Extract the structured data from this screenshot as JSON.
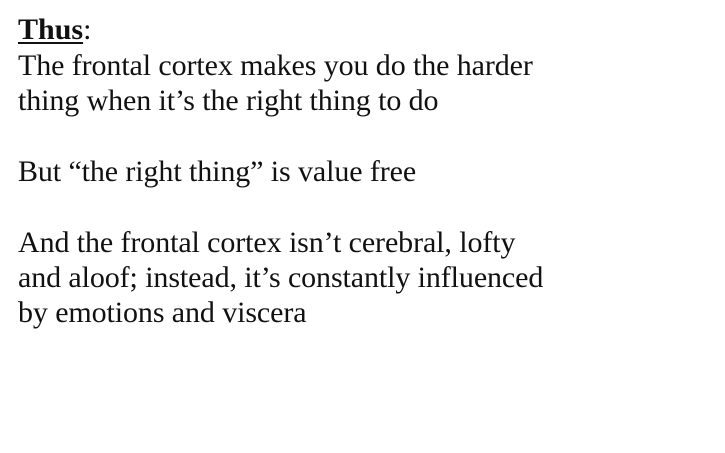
{
  "heading": {
    "word": "Thus",
    "colon": ":"
  },
  "paragraphs": [
    {
      "lines": [
        "The frontal cortex makes you do the harder",
        "thing when it’s the right thing to do"
      ]
    },
    {
      "lines": [
        "But “the right thing” is value free"
      ]
    },
    {
      "lines": [
        "And the frontal cortex isn’t cerebral, lofty",
        "and aloof; instead, it’s constantly influenced",
        "by emotions and viscera"
      ]
    }
  ]
}
